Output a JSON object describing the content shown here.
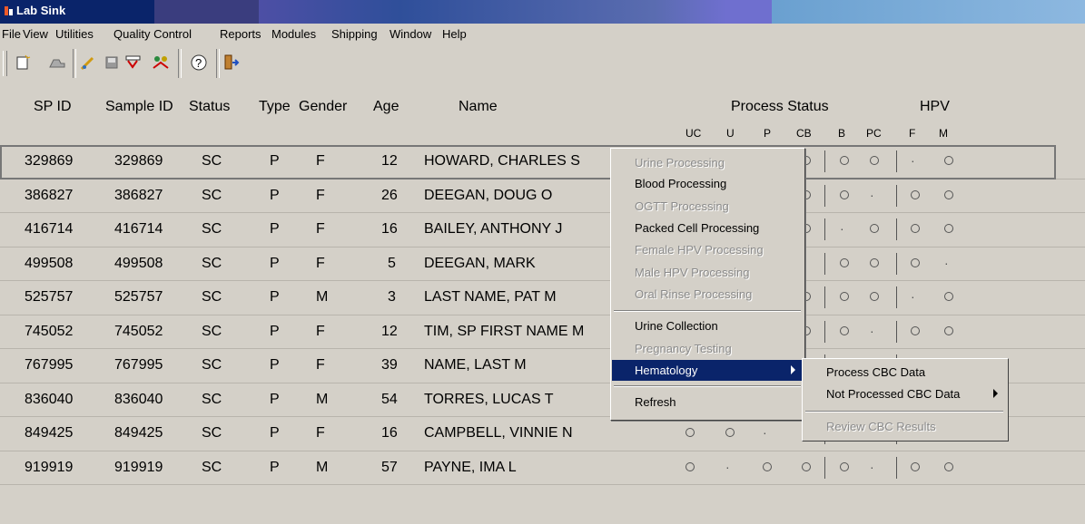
{
  "window": {
    "title": "Lab Sink"
  },
  "menu": [
    "File",
    "View",
    "Utilities",
    "Quality Control",
    "Reports",
    "Modules",
    "Shipping",
    "Window",
    "Help"
  ],
  "toolbar": {
    "icons": [
      "new-icon",
      "save-icon",
      "edit-icon",
      "disk-icon",
      "filter-icon",
      "users-icon",
      "help-icon",
      "exit-icon"
    ],
    "help_glyph": "?"
  },
  "columns": {
    "sp_id": "SP ID",
    "sample_id": "Sample ID",
    "status": "Status",
    "type": "Type",
    "gender": "Gender",
    "age": "Age",
    "name": "Name",
    "process_status": "Process Status",
    "hpv": "HPV",
    "process_sub": [
      "UC",
      "U",
      "P",
      "CB",
      "B",
      "PC"
    ],
    "hpv_sub": [
      "F",
      "M"
    ]
  },
  "rows": [
    {
      "sp_id": "329869",
      "sample_id": "329869",
      "status": "SC",
      "type": "P",
      "gender": "F",
      "age": "12",
      "name": "HOWARD, CHARLES S"
    },
    {
      "sp_id": "386827",
      "sample_id": "386827",
      "status": "SC",
      "type": "P",
      "gender": "F",
      "age": "26",
      "name": "DEEGAN, DOUG O"
    },
    {
      "sp_id": "416714",
      "sample_id": "416714",
      "status": "SC",
      "type": "P",
      "gender": "F",
      "age": "16",
      "name": "BAILEY, ANTHONY J"
    },
    {
      "sp_id": "499508",
      "sample_id": "499508",
      "status": "SC",
      "type": "P",
      "gender": "F",
      "age": "5",
      "name": "DEEGAN, MARK"
    },
    {
      "sp_id": "525757",
      "sample_id": "525757",
      "status": "SC",
      "type": "P",
      "gender": "M",
      "age": "3",
      "name": "LAST NAME, PAT M"
    },
    {
      "sp_id": "745052",
      "sample_id": "745052",
      "status": "SC",
      "type": "P",
      "gender": "F",
      "age": "12",
      "name": "TIM, SP FIRST NAME M"
    },
    {
      "sp_id": "767995",
      "sample_id": "767995",
      "status": "SC",
      "type": "P",
      "gender": "F",
      "age": "39",
      "name": "NAME, LAST M"
    },
    {
      "sp_id": "836040",
      "sample_id": "836040",
      "status": "SC",
      "type": "P",
      "gender": "M",
      "age": "54",
      "name": "TORRES, LUCAS T"
    },
    {
      "sp_id": "849425",
      "sample_id": "849425",
      "status": "SC",
      "type": "P",
      "gender": "F",
      "age": "16",
      "name": "CAMPBELL, VINNIE N"
    },
    {
      "sp_id": "919919",
      "sample_id": "919919",
      "status": "SC",
      "type": "P",
      "gender": "M",
      "age": "57",
      "name": "PAYNE, IMA L"
    }
  ],
  "context_menu": {
    "items": [
      {
        "label": "Urine Processing",
        "enabled": false
      },
      {
        "label": "Blood Processing",
        "enabled": true
      },
      {
        "label": "OGTT Processing",
        "enabled": false
      },
      {
        "label": "Packed Cell Processing",
        "enabled": true
      },
      {
        "label": "Female HPV Processing",
        "enabled": false
      },
      {
        "label": "Male HPV Processing",
        "enabled": false
      },
      {
        "label": "Oral Rinse Processing",
        "enabled": false
      },
      {
        "label": "Urine Collection",
        "enabled": true
      },
      {
        "label": "Pregnancy Testing",
        "enabled": false
      },
      {
        "label": "Hematology",
        "enabled": true,
        "highlighted": true
      },
      {
        "label": "Refresh",
        "enabled": true
      }
    ]
  },
  "submenu": {
    "items": [
      {
        "label": "Process CBC Data",
        "enabled": true
      },
      {
        "label": "Not Processed CBC Data",
        "enabled": true
      },
      {
        "label": "Review CBC Results",
        "enabled": false
      }
    ]
  },
  "colors": {
    "highlight": "#0a246a",
    "face": "#d4d0c8",
    "disabled": "#8a8a8a"
  }
}
